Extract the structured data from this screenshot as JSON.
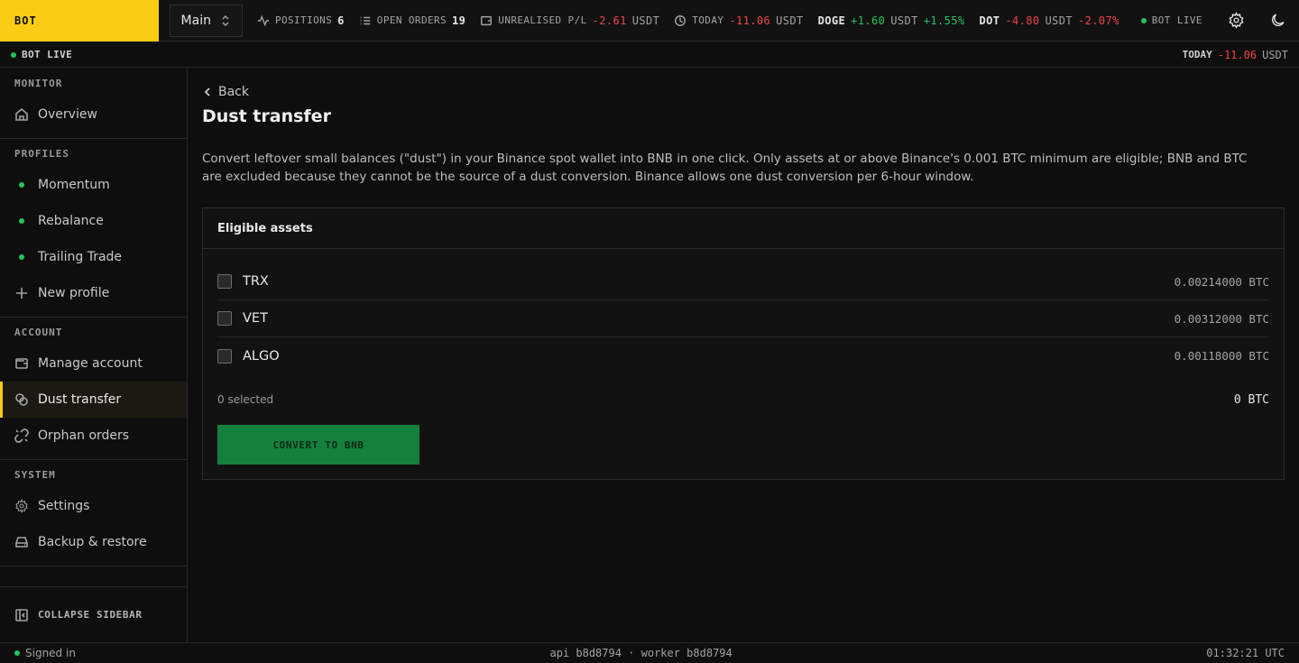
{
  "brand": "BOT",
  "profile_selector": {
    "value": "Main"
  },
  "stats": {
    "positions": {
      "label": "POSITIONS",
      "value": "6"
    },
    "open_orders": {
      "label": "OPEN ORDERS",
      "value": "19"
    },
    "unrealised": {
      "label": "UNREALISED P/L",
      "value": "-2.61",
      "unit": "USDT"
    },
    "today": {
      "label": "TODAY",
      "value": "-11.06",
      "unit": "USDT"
    },
    "doge": {
      "symbol": "DOGE",
      "value": "+1.60",
      "unit": "USDT",
      "pct": "+1.55%"
    },
    "dot": {
      "symbol": "DOT",
      "value": "-4.80",
      "unit": "USDT",
      "pct": "-2.07%"
    },
    "bot_status": "BOT LIVE"
  },
  "strip": {
    "status": "BOT LIVE",
    "today_label": "TODAY",
    "today_value": "-11.06",
    "today_unit": "USDT"
  },
  "sidebar": {
    "monitor": {
      "title": "MONITOR",
      "items": [
        {
          "label": "Overview",
          "icon": "home-icon"
        }
      ]
    },
    "profiles": {
      "title": "PROFILES",
      "items": [
        {
          "label": "Momentum"
        },
        {
          "label": "Rebalance"
        },
        {
          "label": "Trailing Trade"
        },
        {
          "label": "New profile",
          "icon": "plus-icon"
        }
      ]
    },
    "account": {
      "title": "ACCOUNT",
      "items": [
        {
          "label": "Manage account",
          "icon": "wallet-icon"
        },
        {
          "label": "Dust transfer",
          "icon": "coins-icon",
          "active": true
        },
        {
          "label": "Orphan orders",
          "icon": "link-broken-icon"
        }
      ]
    },
    "system": {
      "title": "SYSTEM",
      "items": [
        {
          "label": "Settings",
          "icon": "gear-icon"
        },
        {
          "label": "Backup & restore",
          "icon": "drive-icon"
        }
      ]
    },
    "collapse_label": "COLLAPSE SIDEBAR"
  },
  "main": {
    "back_label": "Back",
    "title": "Dust transfer",
    "description": "Convert leftover small balances (\"dust\") in your Binance spot wallet into BNB in one click. Only assets at or above Binance's 0.001 BTC minimum are eligible; BNB and BTC are excluded because they cannot be the source of a dust conversion. Binance allows one dust conversion per 6-hour window.",
    "card_title": "Eligible assets",
    "assets": [
      {
        "symbol": "TRX",
        "amount": "0.00214000 BTC"
      },
      {
        "symbol": "VET",
        "amount": "0.00312000 BTC"
      },
      {
        "symbol": "ALGO",
        "amount": "0.00118000 BTC"
      }
    ],
    "selected_text": "0 selected",
    "total_text": "0 BTC",
    "convert_label": "CONVERT TO BNB"
  },
  "footer": {
    "signed_in": "Signed in",
    "build": "api b8d8794 · worker b8d8794",
    "time": "01:32:21 UTC"
  },
  "colors": {
    "accent": "#facc15",
    "positive": "#22c55e",
    "negative": "#ef4444",
    "convert_button": "#15803d"
  }
}
